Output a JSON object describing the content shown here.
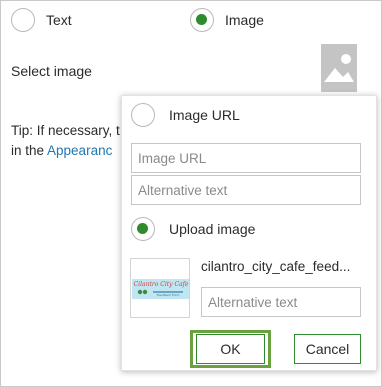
{
  "content_type": {
    "text_label": "Text",
    "image_label": "Image",
    "selected": "Image"
  },
  "select_image": {
    "label": "Select image",
    "placeholder_icon": "image-placeholder-icon"
  },
  "tip": {
    "line1": "Tip: If necessary, t",
    "line2_prefix": "in the ",
    "link": "Appearanc"
  },
  "popup": {
    "image_url": {
      "label": "Image URL",
      "url_placeholder": "Image URL",
      "alt_placeholder": "Alternative text"
    },
    "upload": {
      "label": "Upload image",
      "selected": true,
      "file_name": "cilantro_city_cafe_feed...",
      "alt_placeholder": "Alternative text",
      "thumb_title": "Cilantro City Cafe",
      "thumb_sub": "Feedback Form"
    },
    "ok_label": "OK",
    "cancel_label": "Cancel"
  },
  "colors": {
    "accent_green": "#2e8b2e",
    "focus_outline": "#6ba23f",
    "link_blue": "#1f77b4"
  }
}
